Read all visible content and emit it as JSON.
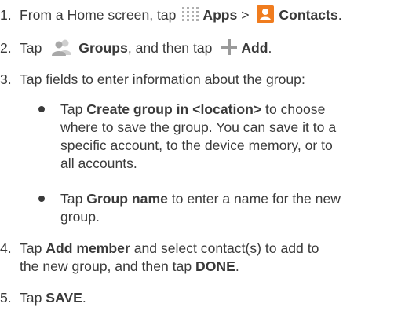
{
  "steps": [
    {
      "num": "1.",
      "prefix": "From a Home screen, tap ",
      "apps_label": "Apps",
      "separator": " > ",
      "contacts_label": "Contacts",
      "suffix": "."
    },
    {
      "num": "2.",
      "prefix": "Tap ",
      "groups_label": "Groups",
      "middle": ", and then tap ",
      "add_label": "Add",
      "suffix": "."
    },
    {
      "num": "3.",
      "text": "Tap fields to enter information about the group:",
      "bullets": [
        {
          "prefix": "Tap ",
          "bold": "Create group in <location>",
          "lines_rest": [
            " to choose",
            "where to save the group. You can save it to a",
            "specific account, to the device memory, or to",
            "all accounts."
          ]
        },
        {
          "prefix": "Tap ",
          "bold": "Group name",
          "lines_rest": [
            " to enter a name for the new",
            "group."
          ]
        }
      ]
    },
    {
      "num": "4.",
      "prefix": "Tap ",
      "bold1": "Add member",
      "middle": " and select contact(s) to add to",
      "line2_prefix": "the new group, and then tap ",
      "bold2": "DONE",
      "suffix": "."
    },
    {
      "num": "5.",
      "prefix": "Tap ",
      "bold": "SAVE",
      "suffix": "."
    }
  ],
  "icons": {
    "apps": "apps-grid-icon",
    "contacts": "contacts-icon",
    "groups": "groups-icon",
    "add": "plus-icon"
  },
  "colors": {
    "text": "#3a3a3a",
    "apps_icon": "#b0b0b0",
    "contacts_icon": "#f07c1e",
    "groups_icon": "#b7b7b7",
    "plus_icon": "#9a9a9a"
  }
}
